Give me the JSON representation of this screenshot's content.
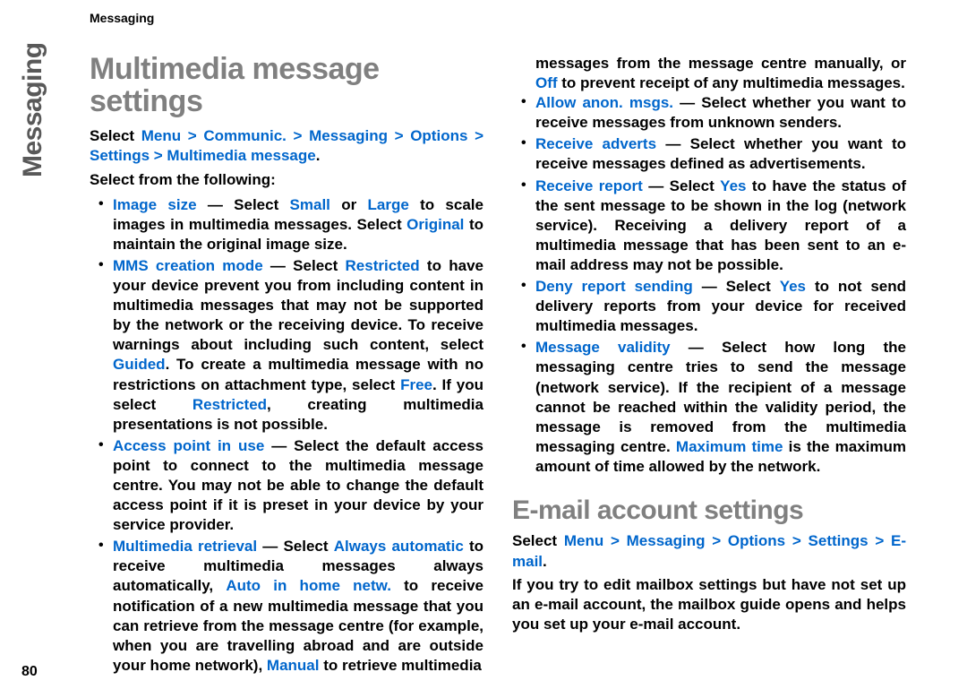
{
  "runningHeader": "Messaging",
  "sideTab": "Messaging",
  "pageNumber": "80",
  "col1": {
    "h1": "Multimedia message settings",
    "nav": {
      "pre": "Select ",
      "path": "Menu > Communic. > Messaging > Options > Settings > Multimedia message",
      "post": "."
    },
    "lead": "Select from the following:",
    "items": [
      {
        "label": "Image size",
        "t1": " — Select ",
        "hl1": "Small",
        "t2": " or ",
        "hl2": "Large",
        "t3": " to scale images in multimedia messages. Select ",
        "hl3": "Original",
        "t4": " to maintain the original image size."
      },
      {
        "label": "MMS creation mode",
        "t1": " — Select ",
        "hl1": "Restricted",
        "t2": " to have your device prevent you from including content in multimedia messages that may not be supported by the network or the receiving device. To receive warnings about including such content, select ",
        "hl2": "Guided",
        "t3": ". To create a multimedia message with no restrictions on attachment type, select ",
        "hl3": "Free",
        "t4": ". If you select ",
        "hl4": "Restricted",
        "t5": ", creating multimedia presentations is not possible."
      },
      {
        "label": "Access point in use",
        "t1": " — Select the default access point to connect to the multimedia message centre. You may not be able to change the default access point if it is preset in your device by your service provider."
      },
      {
        "label": "Multimedia retrieval",
        "t1": " — Select ",
        "hl1": "Always automatic",
        "t2": " to receive multimedia messages always automatically, ",
        "hl2": "Auto in home netw.",
        "t3": " to receive notification of a new multimedia message that you can retrieve from the message centre (for example, when you are travelling abroad and are outside your home network), ",
        "hl3": "Manual",
        "t4": " to retrieve multimedia"
      }
    ]
  },
  "col2": {
    "continuation": {
      "t1": "messages from the message centre manually, or ",
      "hl1": "Off",
      "t2": " to prevent receipt of any multimedia messages."
    },
    "items": [
      {
        "label": "Allow anon. msgs.",
        "t1": " — Select whether you want to receive messages from unknown senders."
      },
      {
        "label": "Receive adverts",
        "t1": " — Select whether you want to receive messages defined as advertisements."
      },
      {
        "label": "Receive report",
        "t1": " — Select ",
        "hl1": "Yes",
        "t2": " to have the status of the sent message to be shown in the log (network service). Receiving a delivery report of a multimedia message that has been sent to an e-mail address may not be possible."
      },
      {
        "label": "Deny report sending",
        "t1": " — Select ",
        "hl1": "Yes",
        "t2": " to not send delivery reports from your device for received multimedia messages."
      },
      {
        "label": "Message validity",
        "t1": " — Select how long the messaging centre tries to send the message (network service). If the recipient of a message cannot be reached within the validity period, the message is removed from the multimedia messaging centre. ",
        "hl1": "Maximum time",
        "t2": " is the maximum amount of time allowed by the network."
      }
    ],
    "h2": "E-mail account settings",
    "nav2": {
      "pre": "Select ",
      "path": "Menu > Messaging > Options > Settings > E-mail",
      "post": "."
    },
    "para": "If you try to edit mailbox settings but have not set up an e-mail account, the mailbox guide opens and helps you set up your e-mail account."
  }
}
